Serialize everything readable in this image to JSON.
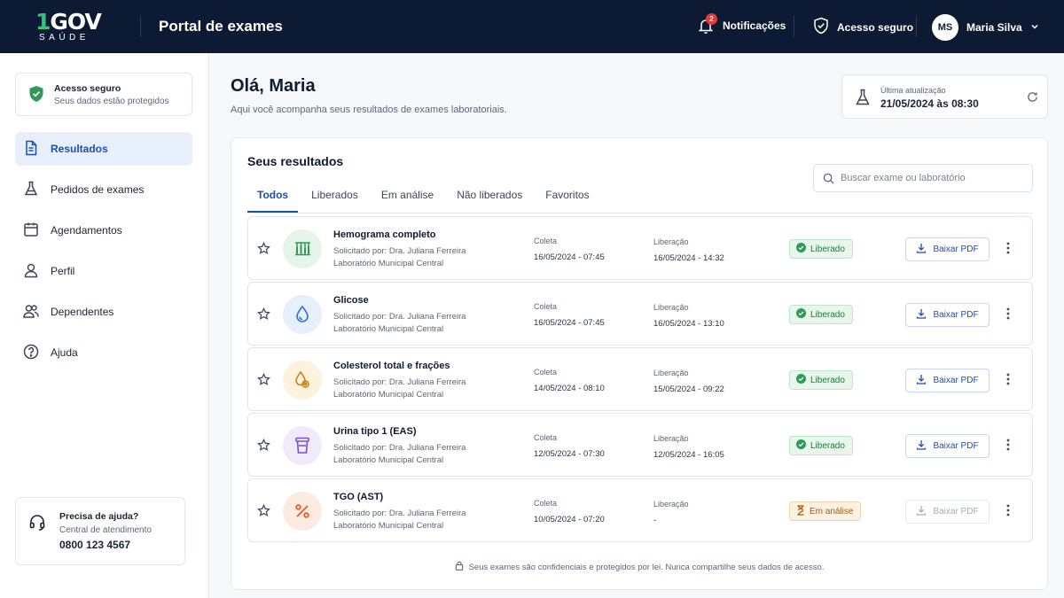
{
  "header": {
    "logo_main": "GOV",
    "logo_digit": "1",
    "logo_sub": "SAÚDE",
    "title": "Portal de exames",
    "notifications_label": "Notificações",
    "notifications_count": "2",
    "secure_label": "Acesso seguro",
    "user_initials": "MS",
    "user_name": "Maria Silva"
  },
  "sidebar": {
    "secure_title": "Acesso seguro",
    "secure_subtitle": "Seus dados estão protegidos",
    "items": [
      {
        "label": "Resultados",
        "icon": "document-icon",
        "active": true
      },
      {
        "label": "Pedidos de exames",
        "icon": "flask-icon",
        "active": false
      },
      {
        "label": "Agendamentos",
        "icon": "calendar-icon",
        "active": false
      },
      {
        "label": "Perfil",
        "icon": "user-icon",
        "active": false
      },
      {
        "label": "Dependentes",
        "icon": "users-icon",
        "active": false
      },
      {
        "label": "Ajuda",
        "icon": "help-icon",
        "active": false
      }
    ],
    "help": {
      "title": "Precisa de ajuda?",
      "subtitle": "Central de atendimento",
      "phone": "0800 123 4567"
    }
  },
  "main": {
    "greeting": "Olá, Maria",
    "subtitle": "Aqui você acompanha seus resultados de exames laboratoriais.",
    "update_label": "Última atualização",
    "update_value": "21/05/2024 às 08:30"
  },
  "results": {
    "title": "Seus resultados",
    "search_placeholder": "Buscar exame ou laboratório",
    "tabs": [
      "Todos",
      "Liberados",
      "Em análise",
      "Não liberados",
      "Favoritos"
    ],
    "active_tab": "Todos",
    "collect_label": "Coleta",
    "release_label": "Liberação",
    "download_label": "Baixar PDF",
    "rows": [
      {
        "name": "Hemograma completo",
        "requested": "Solicitado por: Dra. Juliana Ferreira",
        "lab": "Laboratório Municipal Central",
        "collect": "16/05/2024 - 07:45",
        "release": "16/05/2024 - 14:32",
        "status": "Liberado",
        "icon": "test-tubes-icon",
        "icon_color": "#2f9a55",
        "icon_bg": "#e6f5ea"
      },
      {
        "name": "Glicose",
        "requested": "Solicitado por: Dra. Juliana Ferreira",
        "lab": "Laboratório Municipal Central",
        "collect": "16/05/2024 - 07:45",
        "release": "16/05/2024 - 13:10",
        "status": "Liberado",
        "icon": "drop-icon",
        "icon_color": "#2f6fd6",
        "icon_bg": "#e8effc"
      },
      {
        "name": "Colesterol total e frações",
        "requested": "Solicitado por: Dra. Juliana Ferreira",
        "lab": "Laboratório Municipal Central",
        "collect": "14/05/2024 - 08:10",
        "release": "15/05/2024 - 09:22",
        "status": "Liberado",
        "icon": "lipid-drop-icon",
        "icon_color": "#c9861c",
        "icon_bg": "#fdf2dc"
      },
      {
        "name": "Urina tipo 1 (EAS)",
        "requested": "Solicitado por: Dra. Juliana Ferreira",
        "lab": "Laboratório Municipal Central",
        "collect": "12/05/2024 - 07:30",
        "release": "12/05/2024 - 16:05",
        "status": "Liberado",
        "icon": "sample-cup-icon",
        "icon_color": "#7b4fd0",
        "icon_bg": "#f0eafb"
      },
      {
        "name": "TGO (AST)",
        "requested": "Solicitado por: Dra. Juliana Ferreira",
        "lab": "Laboratório Municipal Central",
        "collect": "10/05/2024 - 07:20",
        "release": "-",
        "status": "Em análise",
        "icon": "percent-icon",
        "icon_color": "#d9622b",
        "icon_bg": "#fdebe2"
      }
    ],
    "footer": "Seus exames são confidenciais e protegidos por lei. Nunca compartilhe seus dados de acesso."
  },
  "colors": {
    "topbar": "#0c1a33",
    "accent": "#1e4fa8",
    "success": "#1d7a3d",
    "warning": "#a55a0c"
  }
}
